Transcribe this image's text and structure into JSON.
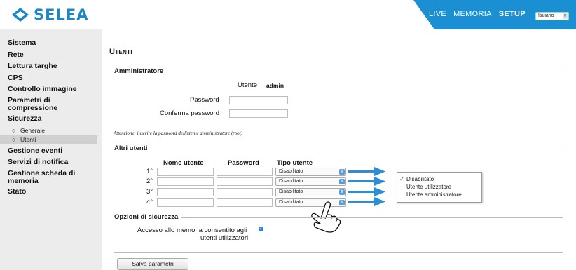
{
  "brand": {
    "name": "SELEA",
    "primary_color": "#1b87c9"
  },
  "nav": {
    "links": [
      {
        "label": "Live",
        "active": false
      },
      {
        "label": "Memoria",
        "active": false
      },
      {
        "label": "Setup",
        "active": true
      }
    ],
    "language": {
      "selected": "Italiano"
    }
  },
  "sidebar": {
    "items": [
      {
        "label": "Sistema"
      },
      {
        "label": "Rete"
      },
      {
        "label": "Lettura targhe"
      },
      {
        "label": "CPS"
      },
      {
        "label": "Controllo immagine"
      },
      {
        "label": "Parametri di compressione"
      },
      {
        "label": "Sicurezza"
      },
      {
        "label": "Gestione eventi"
      },
      {
        "label": "Servizi di notifica"
      },
      {
        "label": "Gestione scheda di memoria"
      },
      {
        "label": "Stato"
      }
    ],
    "sicurezza_sub": [
      {
        "label": "Generale",
        "selected": false
      },
      {
        "label": "Utenti",
        "selected": true
      }
    ]
  },
  "page": {
    "title": "Utenti",
    "admin": {
      "section_title": "Amministratore",
      "user_label": "Utente",
      "user_value": "admin",
      "password_label": "Password",
      "confirm_label": "Conferma password",
      "note": "Attenzione: inserire la password dell'utente amministratore (root)"
    },
    "others": {
      "section_title": "Altri utenti",
      "col_user": "Nome utente",
      "col_password": "Password",
      "col_type": "Tipo utente",
      "rows": [
        {
          "num": "1°",
          "type": "Disabilitato"
        },
        {
          "num": "2°",
          "type": "Disabilitato"
        },
        {
          "num": "3°",
          "type": "Disabilitato"
        },
        {
          "num": "4°",
          "type": "Disabilitato"
        }
      ],
      "type_options": [
        {
          "label": "Disabilitato",
          "checked": true
        },
        {
          "label": "Utente utilizzatore",
          "checked": false
        },
        {
          "label": "Utente amministratore",
          "checked": false
        }
      ]
    },
    "security": {
      "section_title": "Opzioni di sicurezza",
      "memory_access_line1": "Accesso allo memoria consentito agli",
      "memory_access_line2": "utenti utilizzatori",
      "memory_access_checked": true
    },
    "save_label": "Salva parametri"
  },
  "annotations": {
    "arrow_color": "#2a8fd6",
    "icons": [
      "pointing-hand-icon"
    ]
  }
}
